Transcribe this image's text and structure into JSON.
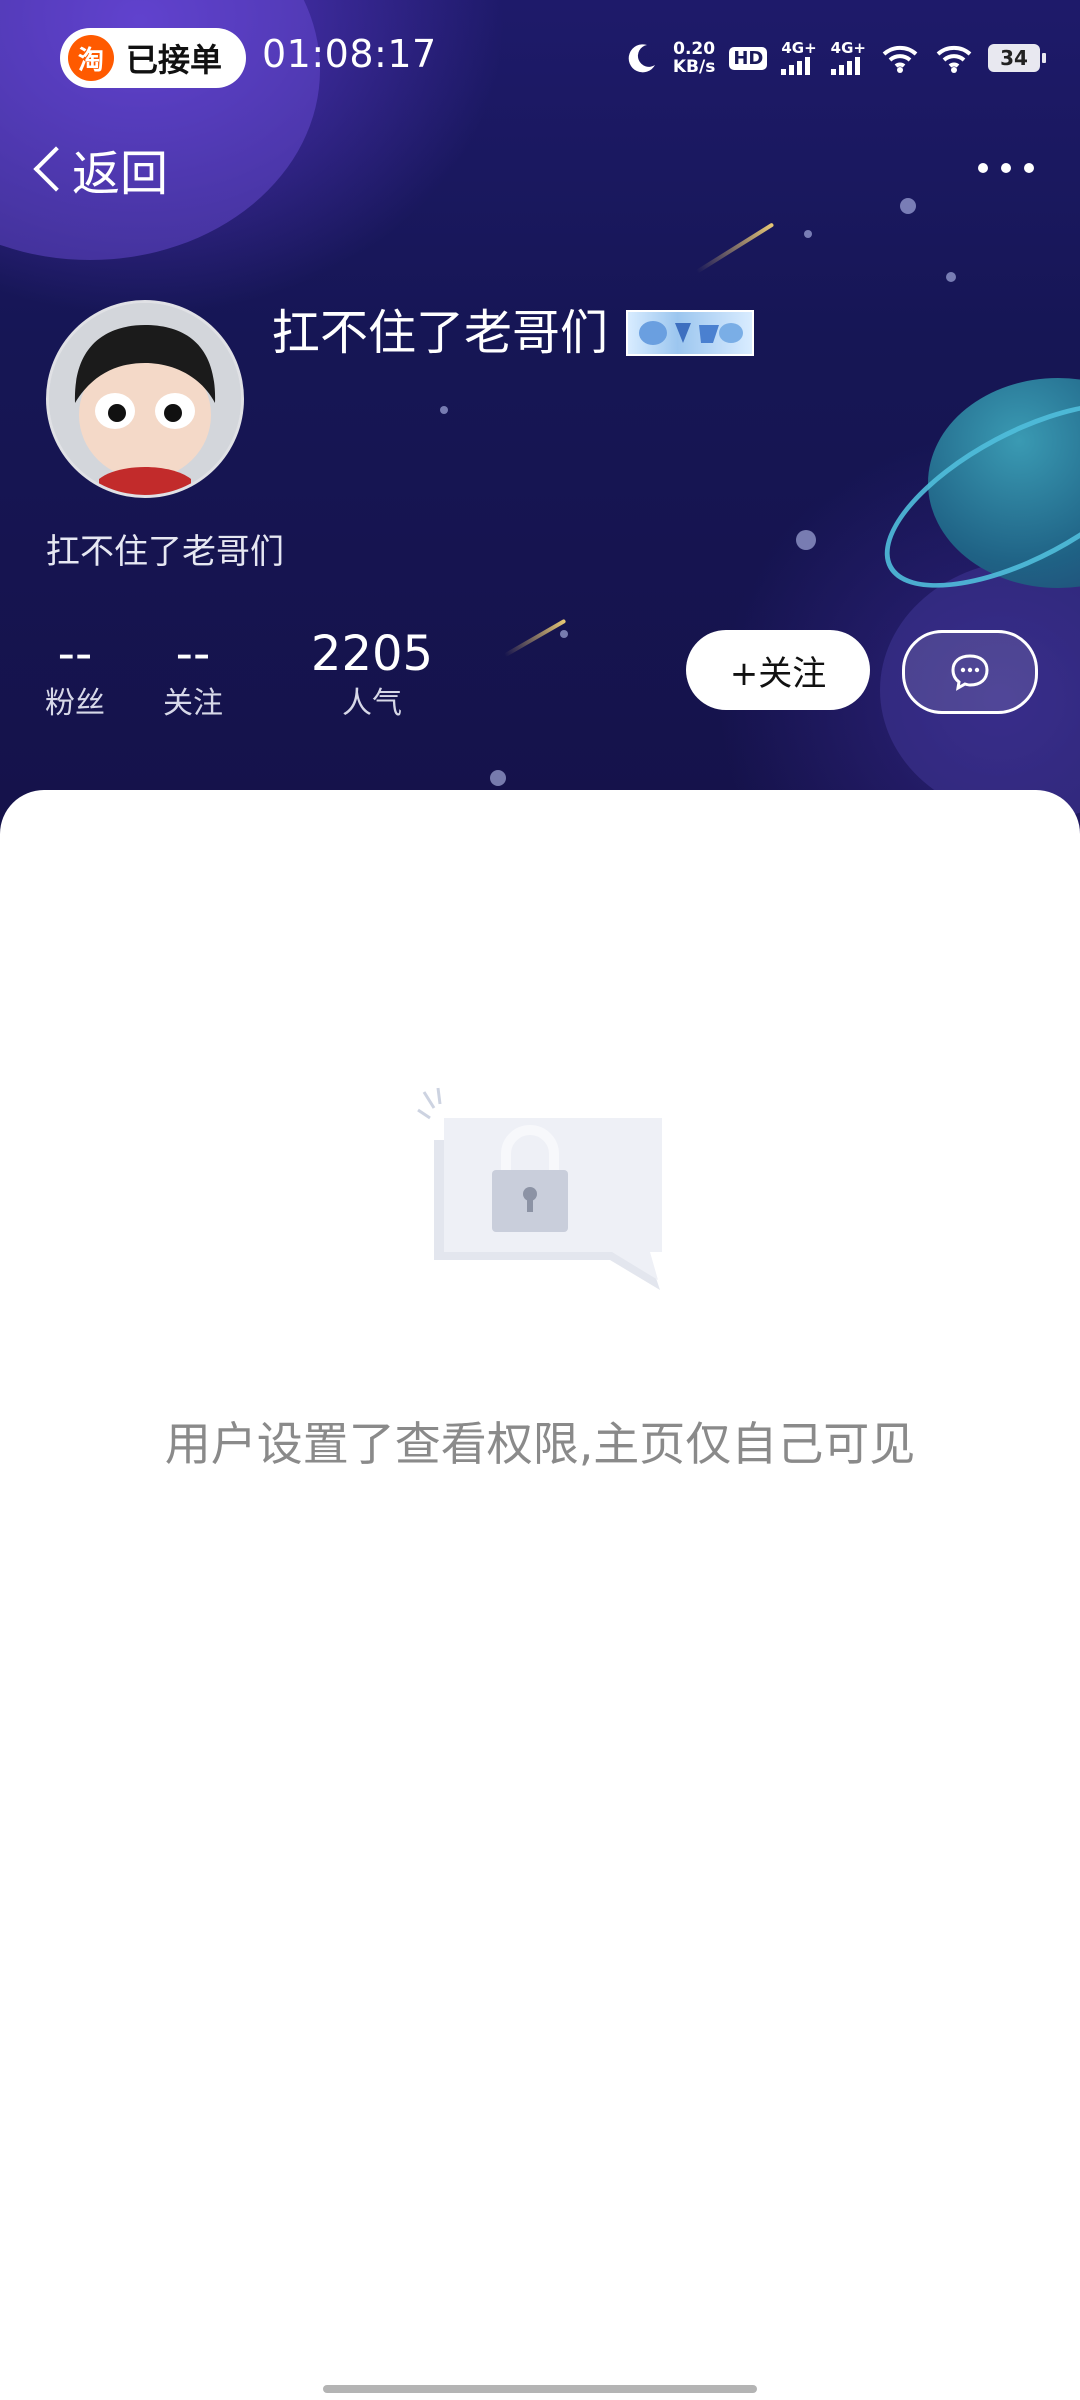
{
  "status_bar": {
    "app_badge_icon": "淘",
    "app_badge_text": "已接单",
    "time": "01:08:17",
    "net_speed_value": "0.20",
    "net_speed_unit": "KB/s",
    "hd_label": "HD",
    "signal_1_label": "4G+",
    "signal_2_label": "4G+",
    "battery": "34"
  },
  "nav": {
    "back_label": "返回"
  },
  "profile": {
    "name": "扛不住了老哥们",
    "bio": "扛不住了老哥们",
    "stats": [
      {
        "value": "--",
        "label": "粉丝"
      },
      {
        "value": "--",
        "label": "关注"
      },
      {
        "value": "2205",
        "label": "人气"
      }
    ],
    "follow_button": "+关注"
  },
  "empty_state": {
    "message": "用户设置了查看权限,主页仅自己可见"
  },
  "colors": {
    "header_bg": "#17145a",
    "accent_white": "#ffffff",
    "empty_text": "#8a8a8a"
  }
}
